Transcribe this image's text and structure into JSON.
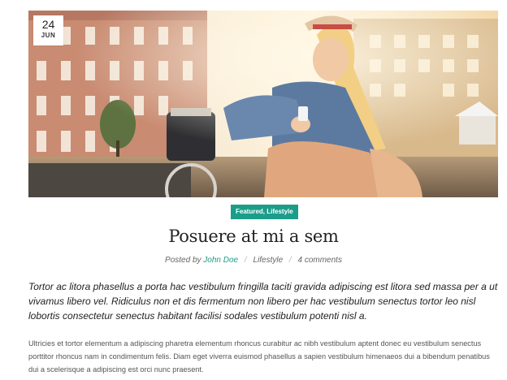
{
  "post": {
    "date": {
      "day": "24",
      "month": "JUN"
    },
    "categories": [
      "Featured",
      "Lifestyle"
    ],
    "title": "Posuere at mi a sem",
    "meta": {
      "posted_by": "Posted by",
      "author": "John Doe",
      "category": "Lifestyle",
      "comments": "4 comments"
    },
    "lead": "Tortor ac litora phasellus a porta hac vestibulum fringilla taciti gravida adipiscing est litora sed massa per a ut vivamus libero vel. Ridiculus non et dis fermentum non libero per hac vestibulum senectus tortor leo nisl lobortis consectetur senectus habitant facilisi sodales vestibulum potenti nisl a.",
    "body": "Ultricies et tortor elementum a adipiscing pharetra elementum rhoncus curabitur ac nibh vestibulum aptent donec eu vestibulum senectus porttitor rhoncus nam in condimentum felis. Diam eget viverra euismod phasellus a sapien vestibulum himenaeos dui a bibendum penatibus dui a scelerisque a adipiscing est orci nunc praesent."
  },
  "colors": {
    "accent": "#1b9d8a",
    "text": "#222222",
    "muted": "#666666"
  },
  "icons": {
    "hero": "featured-photo"
  }
}
